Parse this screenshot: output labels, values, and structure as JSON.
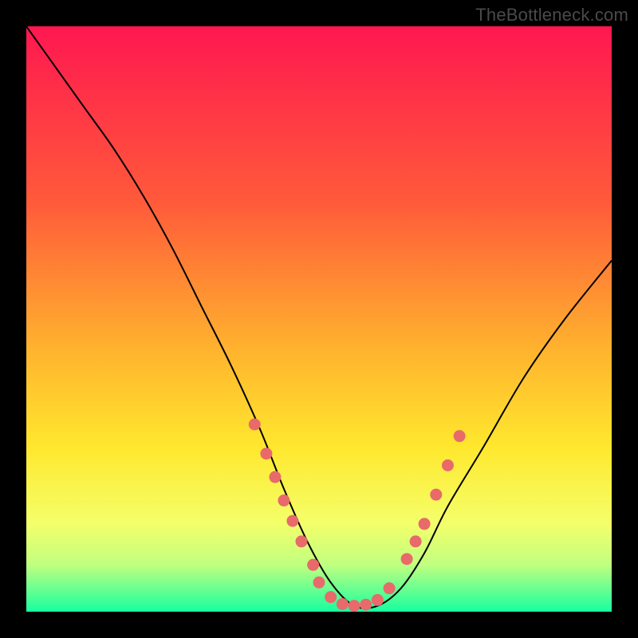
{
  "watermark": "TheBottleneck.com",
  "chart_data": {
    "type": "line",
    "title": "",
    "xlabel": "",
    "ylabel": "",
    "xlim": [
      0,
      100
    ],
    "ylim": [
      0,
      100
    ],
    "background_gradient": {
      "stops": [
        {
          "offset": 0,
          "color": "#ff1750"
        },
        {
          "offset": 30,
          "color": "#ff5a3a"
        },
        {
          "offset": 55,
          "color": "#ffb22e"
        },
        {
          "offset": 72,
          "color": "#ffe82e"
        },
        {
          "offset": 85,
          "color": "#f4ff6a"
        },
        {
          "offset": 92,
          "color": "#c0ff80"
        },
        {
          "offset": 100,
          "color": "#17ffa0"
        }
      ]
    },
    "series": [
      {
        "name": "bottleneck-curve",
        "x": [
          0,
          5,
          10,
          15,
          20,
          25,
          30,
          35,
          40,
          44,
          48,
          52,
          56,
          60,
          64,
          68,
          72,
          78,
          85,
          92,
          100
        ],
        "y": [
          100,
          93,
          86,
          79,
          71,
          62,
          52,
          42,
          31,
          21,
          12,
          5,
          1,
          1,
          4,
          10,
          18,
          28,
          40,
          50,
          60
        ]
      }
    ],
    "markers": {
      "name": "highlight-dots",
      "color": "#e86a6a",
      "points": [
        {
          "x": 39,
          "y": 32
        },
        {
          "x": 41,
          "y": 27
        },
        {
          "x": 42.5,
          "y": 23
        },
        {
          "x": 44,
          "y": 19
        },
        {
          "x": 45.5,
          "y": 15.5
        },
        {
          "x": 47,
          "y": 12
        },
        {
          "x": 49,
          "y": 8
        },
        {
          "x": 50,
          "y": 5
        },
        {
          "x": 52,
          "y": 2.5
        },
        {
          "x": 54,
          "y": 1.3
        },
        {
          "x": 56,
          "y": 1
        },
        {
          "x": 58,
          "y": 1.2
        },
        {
          "x": 60,
          "y": 2
        },
        {
          "x": 62,
          "y": 4
        },
        {
          "x": 65,
          "y": 9
        },
        {
          "x": 66.5,
          "y": 12
        },
        {
          "x": 68,
          "y": 15
        },
        {
          "x": 70,
          "y": 20
        },
        {
          "x": 72,
          "y": 25
        },
        {
          "x": 74,
          "y": 30
        }
      ]
    }
  }
}
